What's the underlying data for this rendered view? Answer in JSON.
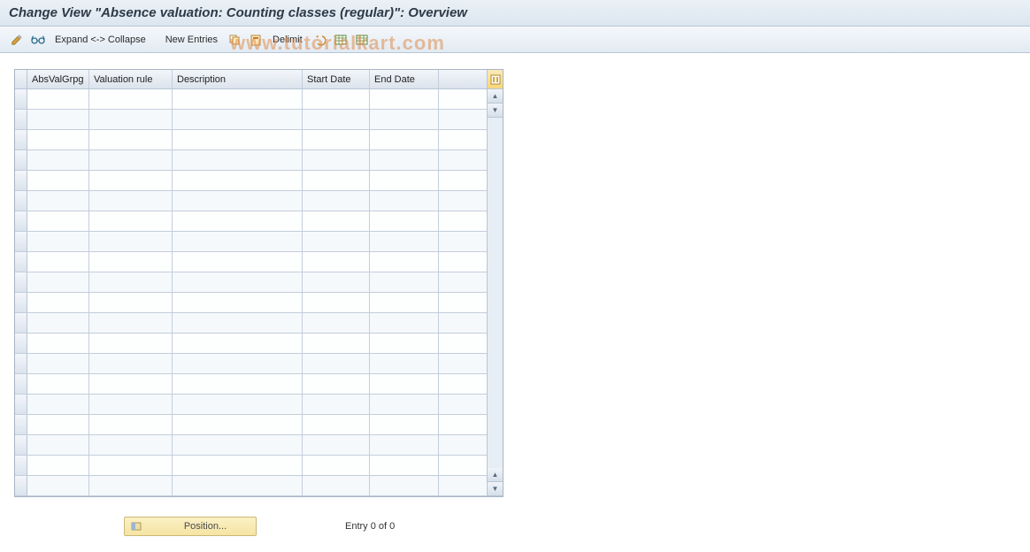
{
  "title": "Change View \"Absence valuation: Counting classes (regular)\": Overview",
  "toolbar": {
    "expand_collapse": "Expand <-> Collapse",
    "new_entries": "New Entries",
    "delimit": "Delimit"
  },
  "watermark": "www.tutorialkart.com",
  "table": {
    "columns": [
      "AbsValGrpg",
      "Valuation rule",
      "Description",
      "Start Date",
      "End Date"
    ],
    "rows": [
      [
        "",
        "",
        "",
        "",
        ""
      ],
      [
        "",
        "",
        "",
        "",
        ""
      ],
      [
        "",
        "",
        "",
        "",
        ""
      ],
      [
        "",
        "",
        "",
        "",
        ""
      ],
      [
        "",
        "",
        "",
        "",
        ""
      ],
      [
        "",
        "",
        "",
        "",
        ""
      ],
      [
        "",
        "",
        "",
        "",
        ""
      ],
      [
        "",
        "",
        "",
        "",
        ""
      ],
      [
        "",
        "",
        "",
        "",
        ""
      ],
      [
        "",
        "",
        "",
        "",
        ""
      ],
      [
        "",
        "",
        "",
        "",
        ""
      ],
      [
        "",
        "",
        "",
        "",
        ""
      ],
      [
        "",
        "",
        "",
        "",
        ""
      ],
      [
        "",
        "",
        "",
        "",
        ""
      ],
      [
        "",
        "",
        "",
        "",
        ""
      ],
      [
        "",
        "",
        "",
        "",
        ""
      ],
      [
        "",
        "",
        "",
        "",
        ""
      ],
      [
        "",
        "",
        "",
        "",
        ""
      ],
      [
        "",
        "",
        "",
        "",
        ""
      ],
      [
        "",
        "",
        "",
        "",
        ""
      ]
    ]
  },
  "footer": {
    "position_label": "Position...",
    "entry_text": "Entry 0 of 0"
  }
}
